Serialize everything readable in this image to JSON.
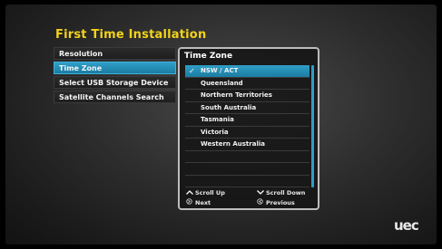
{
  "title": "First Time Installation",
  "menu": [
    {
      "label": "Resolution",
      "selected": false
    },
    {
      "label": "Time Zone",
      "selected": true
    },
    {
      "label": "Select USB Storage Device",
      "selected": false
    },
    {
      "label": "Satellite Channels Search",
      "selected": false
    }
  ],
  "panel": {
    "title": "Time Zone",
    "items": [
      {
        "label": "NSW / ACT",
        "checked": true
      },
      {
        "label": "Queensland",
        "checked": false
      },
      {
        "label": "Northern Territories",
        "checked": false
      },
      {
        "label": "South Australia",
        "checked": false
      },
      {
        "label": "Tasmania",
        "checked": false
      },
      {
        "label": "Victoria",
        "checked": false
      },
      {
        "label": "Western Australia",
        "checked": false
      },
      {
        "label": "",
        "checked": false
      },
      {
        "label": "",
        "checked": false
      },
      {
        "label": "",
        "checked": false
      }
    ],
    "check_glyph": "✓"
  },
  "hints": {
    "scroll_up": "Scroll Up",
    "scroll_down": "Scroll Down",
    "next": "Next",
    "previous": "Previous"
  },
  "brand": "uec",
  "colors": {
    "title": "#f2d21a",
    "highlight": "#2f9ec6",
    "panel_border": "#bdbdbd"
  }
}
